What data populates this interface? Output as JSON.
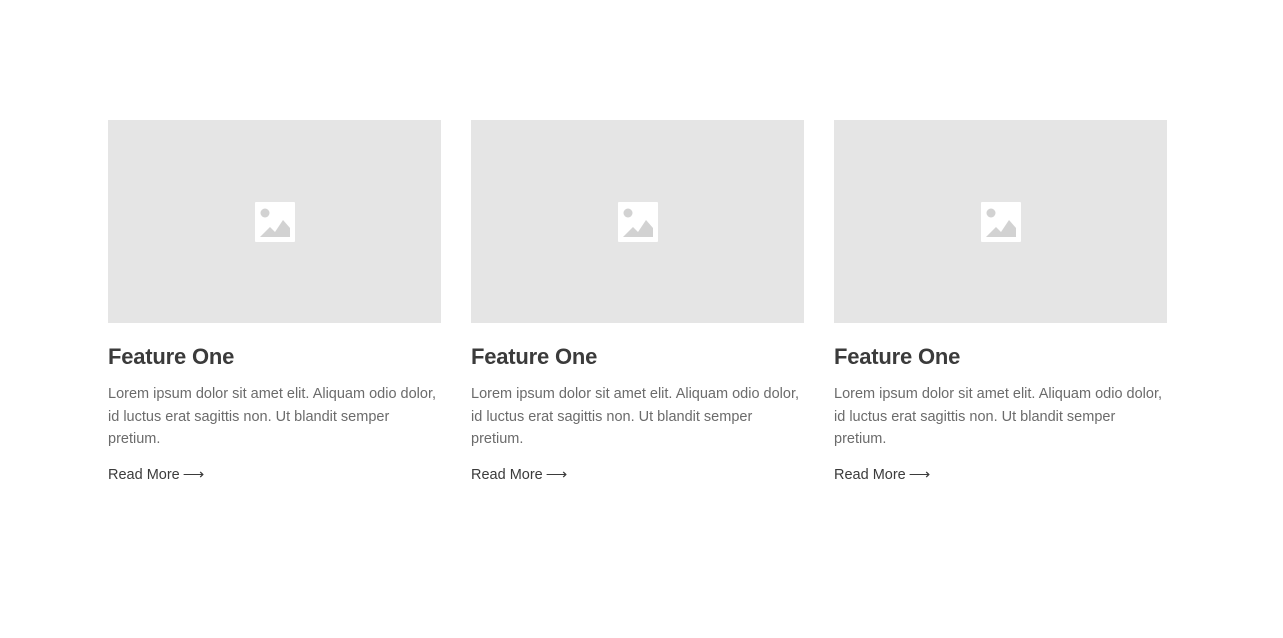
{
  "features": [
    {
      "title": "Feature One",
      "text": "Lorem ipsum dolor sit amet elit. Aliquam odio dolor, id luctus erat sagittis non. Ut blandit semper pretium.",
      "link_label": "Read More",
      "image_icon": "image-placeholder-icon",
      "link_icon": "arrow-right-icon"
    },
    {
      "title": "Feature One",
      "text": "Lorem ipsum dolor sit amet elit. Aliquam odio dolor, id luctus erat sagittis non. Ut blandit semper pretium.",
      "link_label": "Read More",
      "image_icon": "image-placeholder-icon",
      "link_icon": "arrow-right-icon"
    },
    {
      "title": "Feature One",
      "text": "Lorem ipsum dolor sit amet elit. Aliquam odio dolor, id luctus erat sagittis non. Ut blandit semper pretium.",
      "link_label": "Read More",
      "image_icon": "image-placeholder-icon",
      "link_icon": "arrow-right-icon"
    }
  ],
  "colors": {
    "page_background": "#ffffff",
    "image_placeholder": "#e5e5e5",
    "heading": "#3b3b3b",
    "body_text": "#6b6b6b"
  }
}
